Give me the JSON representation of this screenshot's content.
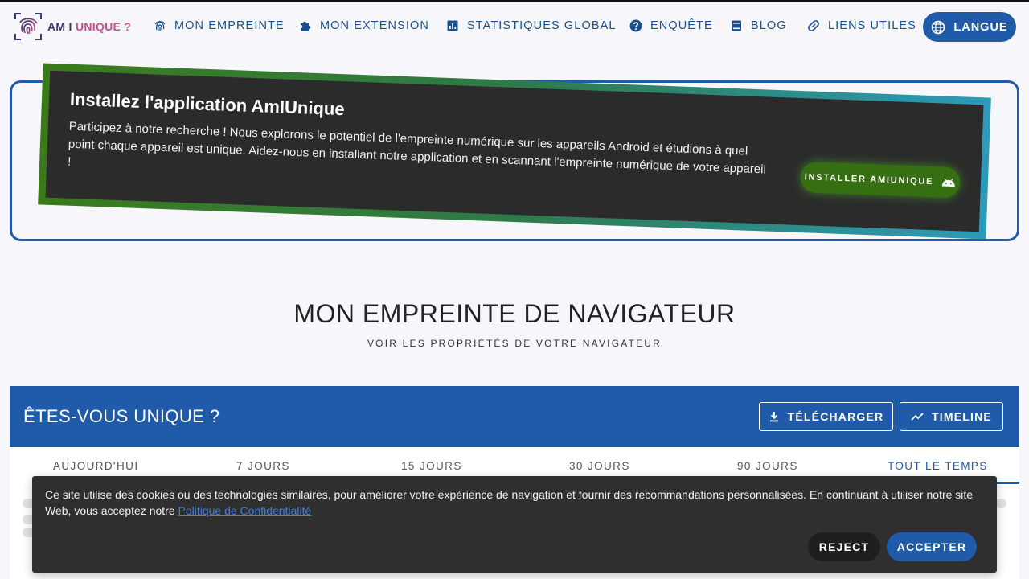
{
  "logo": {
    "part1": "AM I ",
    "part2": "UNIQUE ?"
  },
  "nav": {
    "items": [
      {
        "label": "MON EMPREINTE",
        "icon": "fingerprint-icon"
      },
      {
        "label": "MON EXTENSION",
        "icon": "puzzle-icon"
      },
      {
        "label": "STATISTIQUES GLOBAL",
        "icon": "bar-chart-icon"
      },
      {
        "label": "ENQUÊTE",
        "icon": "help-circle-icon"
      },
      {
        "label": "BLOG",
        "icon": "book-icon"
      },
      {
        "label": "LIENS UTILES",
        "icon": "link-icon"
      }
    ],
    "language_label": "LANGUE"
  },
  "banner": {
    "title": "Installez l'application AmIUnique",
    "text": "Participez à notre recherche ! Nous explorons le potentiel de l'empreinte numérique sur les appareils Android et étudions à quel point chaque appareil est unique. Aidez-nous en installant notre application et en scannant l'empreinte numérique de votre appareil !",
    "button_label": "INSTALLER AMIUNIQUE"
  },
  "heading": {
    "title": "MON EMPREINTE DE NAVIGATEUR",
    "subtitle": "VOIR LES PROPRIÉTÉS DE VOTRE NAVIGATEUR"
  },
  "panel": {
    "title": "ÊTES-VOUS UNIQUE ?",
    "download_label": "TÉLÉCHARGER",
    "timeline_label": "TIMELINE",
    "tabs": [
      "AUJOURD'HUI",
      "7 JOURS",
      "15 JOURS",
      "30 JOURS",
      "90 JOURS",
      "TOUT LE TEMPS"
    ],
    "active_tab": "TOUT LE TEMPS"
  },
  "cookie": {
    "text": "Ce site utilise des cookies ou des technologies similaires, pour améliorer votre expérience de navigation et fournir des recommandations personnalisées. En continuant à utiliser notre site Web, vous acceptez notre ",
    "link": "Politique de Confidentialité",
    "reject_label": "REJECT",
    "accept_label": "ACCEPTER"
  },
  "colors": {
    "primary": "#1f5ba8",
    "banner_dark": "#2b2b2b",
    "android_green": "#356f12",
    "cookie_bg": "#2f2f2f"
  }
}
